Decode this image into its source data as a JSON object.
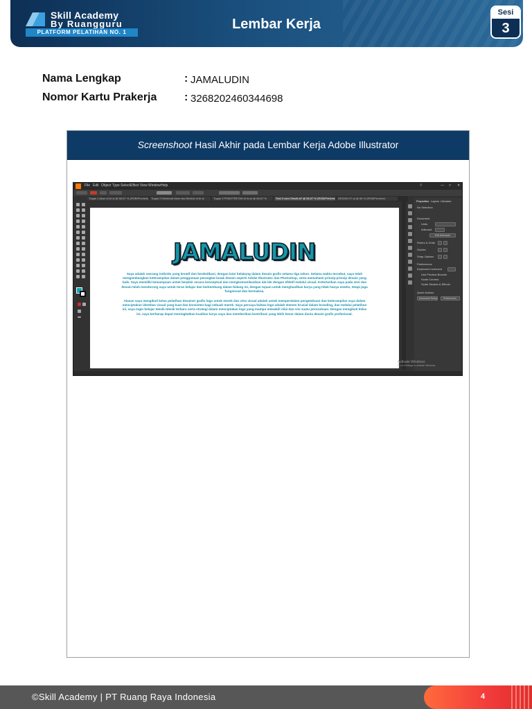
{
  "header": {
    "brand_line1": "Skill Academy",
    "brand_line2": "By Ruangguru",
    "brand_tagline": "PLATFORM PELATIHAN NO. 1",
    "title": "Lembar Kerja",
    "session_label": "Sesi",
    "session_number": "3",
    "colors": {
      "navy": "#0d2f55",
      "accent": "#1f86c8"
    }
  },
  "info": [
    {
      "label": "Nama Lengkap",
      "value": "JAMALUDIN"
    },
    {
      "label": "Nomor Kartu Prakerja",
      "value": "3268202460344698"
    }
  ],
  "worksheet": {
    "title_italic": "Screenshoot",
    "title_rest": " Hasil Akhir pada Lembar Kerja Adobe Illustrator",
    "header_color": "#0e3a66"
  },
  "illustrator": {
    "menu": [
      "File",
      "Edit",
      "Object",
      "Type",
      "Select",
      "Effect",
      "View",
      "Window",
      "Help"
    ],
    "tabs": [
      "Tugas 1 Akun di AI.ai @ 66,67 % (RGB/Preview)",
      "Tugas 2 Membuat Alam dan Bentuk di AI.ai",
      "Tugas 3 PEMOTRETAN di AI.ai @ 66,67 %",
      "Sesi 3 cam Ginulit.ai* @ 66,67 % (RGB/Preview)",
      "DESAIN 07.ai @ 66 % (RGB/Preview)"
    ],
    "artwork_name": "JAMALUDIN",
    "paragraph1": "Saya adalah seorang individu yang kreatif dan berdedikasi, dengan latar belakang dalam desain grafis selama tiga tahun. Selama waktu tersebut, saya telah mengembangkan keterampilan dalam penggunaan perangkat lunak desain seperti Adobe Illustrator dan Photoshop, serta memahami prinsip-prinsip desain yang baik. Saya memiliki kemampuan untuk berpikir secara konseptual dan mengkomunikasikan ide-ide dengan efektif melalui visual. Ketertarikan saya pada seni dan desain telah mendorong saya untuk terus belajar dan berkembang dalam bidang ini, dengan tujuan untuk menghasilkan karya yang tidak hanya estetis, tetapi juga fungsional dan bermakna.",
    "paragraph2": "Alasan saya mengikuti kelas pelatihan desainer grafis logo untuk merek dan citra visual adalah untuk memperdalam pengetahuan dan keterampilan saya dalam menciptakan identitas visual yang kuat dan konsisten bagi sebuah merek. Saya percaya bahwa logo adalah elemen krusial dalam branding, dan melalui pelatihan ini, saya ingin belajar teknik-teknik terbaru serta strategi dalam menciptakan logo yang mampu mewakili nilai dan visi suatu perusahaan. Dengan mengikuti kelas ini, saya berharap dapat meningkatkan kualitas karya saya dan memberikan kontribusi yang lebih besar dalam dunia desain grafis profesional.",
    "panel_tabs": [
      "Properties",
      "Layers",
      "Libraries"
    ],
    "panel_labels": [
      "No Selection",
      "Document",
      "Units",
      "Artboard",
      "Edit Artboards",
      "Rulers & Grids",
      "Guides",
      "Snap Options",
      "Preferences",
      "Keyboard Increment",
      "Use Preview Bounds",
      "Scale Corners",
      "Scale Strokes & Effects",
      "Quick Actions",
      "Document Setup",
      "Preferences"
    ],
    "watermark_line1": "Activate Windows",
    "watermark_line2": "Go to Settings to activate Windows.",
    "fill_color": "#10a6b4",
    "text_color": "#1a8fae"
  },
  "footer": {
    "copyright": "©Skill Academy | PT Ruang Raya Indonesia",
    "page_number": "4",
    "accent": "#f23b3b"
  }
}
